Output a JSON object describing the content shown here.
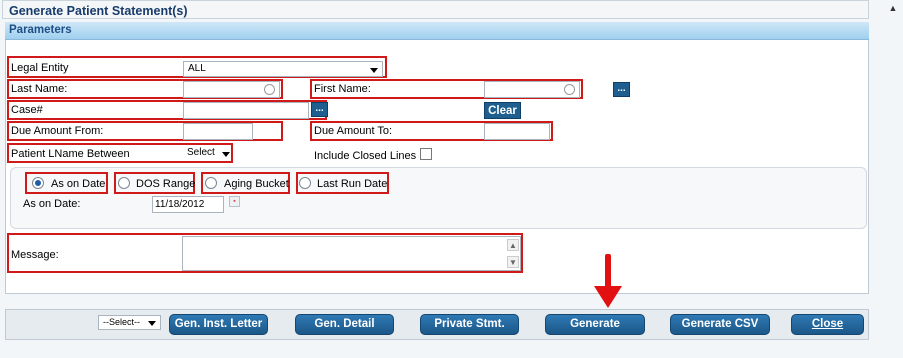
{
  "title": "Generate Patient Statement(s)",
  "parameters_header": "Parameters",
  "legal_entity": {
    "label": "Legal Entity",
    "value": "ALL"
  },
  "last_name": {
    "label": "Last Name:",
    "value": ""
  },
  "first_name": {
    "label": "First Name:",
    "value": ""
  },
  "case": {
    "label": "Case#",
    "value": ""
  },
  "lookup_button": "...",
  "clear_button": "Clear",
  "due_from": {
    "label": "Due Amount From:",
    "value": ""
  },
  "due_to": {
    "label": "Due Amount To:",
    "value": ""
  },
  "lname_between": {
    "label": "Patient LName Between",
    "value": "Select"
  },
  "include_closed": {
    "label": "Include Closed Lines",
    "checked": false
  },
  "date_options": [
    {
      "label": "As on Date",
      "checked": true
    },
    {
      "label": "DOS Range",
      "checked": false
    },
    {
      "label": "Aging Bucket",
      "checked": false
    },
    {
      "label": "Last Run Date",
      "checked": false
    }
  ],
  "as_on_date": {
    "label": "As on Date:",
    "value": "11/18/2012"
  },
  "message": {
    "label": "Message:",
    "value": ""
  },
  "footer": {
    "select_value": "--Select--",
    "buttons": [
      "Gen. Inst. Letter",
      "Gen. Detail",
      "Private Stmt.",
      "Generate",
      "Generate CSV",
      "Close"
    ]
  },
  "colors": {
    "header_text": "#173b6a",
    "button": "#1f5f8f",
    "highlight": "#d01a1a"
  },
  "icons": [
    "scroll-up-icon",
    "dropdown-caret-icon",
    "lookup-circle-icon",
    "calendar-icon",
    "red-down-arrow-icon",
    "checkbox-icon",
    "radio-icon"
  ]
}
